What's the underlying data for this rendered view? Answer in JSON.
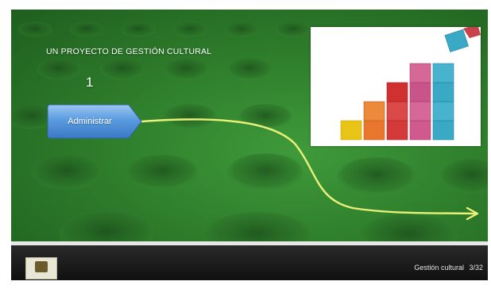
{
  "slide": {
    "title": "UN PROYECTO DE GESTIÓN CULTURAL",
    "step_number": "1",
    "action_button": "Administrar"
  },
  "footer": {
    "caption": "Gestión cultural",
    "page": "3/32"
  },
  "colors": {
    "background_green": "#2f7f2c",
    "button_blue": "#4f8fd6",
    "curve_yellow": "#e9f07a",
    "footer_dark": "#141414"
  },
  "picture": {
    "block_colors": [
      "#e8c417",
      "#e8762c",
      "#d43a3a",
      "#d05a8e",
      "#3aa9c6"
    ]
  }
}
